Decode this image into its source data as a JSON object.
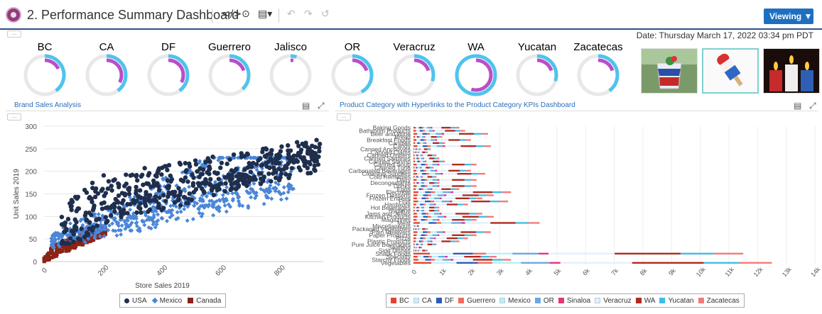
{
  "header": {
    "title": "2. Performance Summary Dashboard",
    "toolbar": {
      "code": "</>",
      "history": "⊙",
      "export": "▤▾",
      "undo": "↶",
      "redo": "↷",
      "reset": "↺"
    },
    "viewing_label": "Viewing ▼",
    "more": "..."
  },
  "date_text": "Date: Thursday March 17, 2022 03:34 pm PDT",
  "kpis": [
    {
      "label": "BC",
      "fraction": 0.18
    },
    {
      "label": "CA",
      "fraction": 0.33
    },
    {
      "label": "DF",
      "fraction": 0.33
    },
    {
      "label": "Guerrero",
      "fraction": 0.2
    },
    {
      "label": "Jalisco",
      "fraction": 0.03
    },
    {
      "label": "OR",
      "fraction": 0.2
    },
    {
      "label": "Veracruz",
      "fraction": 0.2
    },
    {
      "label": "WA",
      "fraction": 0.55
    },
    {
      "label": "Yucatan",
      "fraction": 0.2
    },
    {
      "label": "Zacatecas",
      "fraction": 0.2
    }
  ],
  "kpi_outer_fractions": [
    0.4,
    0.4,
    0.4,
    0.38,
    0.05,
    0.42,
    0.3,
    1.0,
    0.3,
    0.4
  ],
  "images": [
    {
      "name": "drink-image"
    },
    {
      "name": "popsicle-image"
    },
    {
      "name": "candles-image"
    }
  ],
  "panels": {
    "left_title": "Brand Sales Analysis",
    "right_title": "Product Category with Hyperlinks to the Product Category KPIs Dashboard"
  },
  "chart_data": [
    {
      "type": "scatter",
      "title": "",
      "xlabel": "Store Sales 2019",
      "ylabel": "Unit Sales 2019",
      "xlim": [
        0,
        950
      ],
      "ylim": [
        0,
        300
      ],
      "x_ticks": [
        "0",
        "200",
        "400",
        "600",
        "800"
      ],
      "y_ticks": [
        "0",
        "50",
        "100",
        "150",
        "200",
        "250",
        "300"
      ],
      "grid": true,
      "legend_position": "bottom",
      "series": [
        {
          "name": "USA",
          "color": "#1e2e4c",
          "marker": "circle",
          "x_range": [
            0,
            940
          ],
          "y_range": [
            15,
            270
          ]
        },
        {
          "name": "Mexico",
          "color": "#4a86d8",
          "marker": "diamond",
          "x_range": [
            0,
            850
          ],
          "y_range": [
            10,
            230
          ]
        },
        {
          "name": "Canada",
          "color": "#8b2317",
          "marker": "square",
          "x_range": [
            0,
            210
          ],
          "y_range": [
            0,
            75
          ]
        }
      ]
    },
    {
      "type": "bar",
      "orientation": "horizontal",
      "stacked": true,
      "title": "",
      "x_ticks": [
        "0",
        "1k",
        "2k",
        "3k",
        "4k",
        "5k",
        "6k",
        "7k",
        "8k",
        "9k",
        "10k",
        "11k",
        "12k",
        "13k",
        "14k"
      ],
      "xlim": [
        0,
        14000
      ],
      "categories": [
        "Baking Goods",
        "Bathroom Products",
        "Beer and Wine",
        "Bread",
        "Breakfast Foods",
        "Candles",
        "Candy",
        "Canned Anchovies",
        "Canned Clams",
        "Canned Oysters",
        "Canned Sardines",
        "Canned Shrimp",
        "Canned Soup",
        "Canned Tuna",
        "Carbonated Beverages",
        "Cleaning Supplies",
        "Cold Remedies",
        "Dairy",
        "Decongestants",
        "Drinks",
        "Eggs",
        "Electrical",
        "Frozen Desserts",
        "Frozen Entrees",
        "Fruit",
        "Hardware",
        "Hot Beverages",
        "Hygiene",
        "Jams and Jellies",
        "Kitchen Products",
        "Magazines",
        "Meat",
        "Miscellaneous",
        "Packaged Vegetables",
        "Pain Relievers",
        "Paper Products",
        "Pizza",
        "Plastic Products",
        "Pure Juice Beverages",
        "Seafood",
        "Side Dishes",
        "Snack Foods",
        "Specialty",
        "Starchy Foods",
        "Vegetables"
      ],
      "totals": [
        1600,
        1800,
        2600,
        1000,
        2000,
        1100,
        2700,
        600,
        500,
        800,
        900,
        1100,
        2200,
        700,
        2000,
        2500,
        800,
        2200,
        900,
        2200,
        1600,
        3400,
        2800,
        2400,
        3300,
        1900,
        900,
        900,
        2400,
        2800,
        2200,
        4400,
        200,
        500,
        2700,
        2200,
        1900,
        1600,
        800,
        300,
        500,
        11500,
        2900,
        3400,
        12500
      ],
      "series": [
        {
          "name": "BC",
          "color": "#e8402b"
        },
        {
          "name": "CA",
          "color": "#cdeef6"
        },
        {
          "name": "DF",
          "color": "#2d5bb8"
        },
        {
          "name": "Guerrero",
          "color": "#f26a5c"
        },
        {
          "name": "Mexico",
          "color": "#b8f0f4"
        },
        {
          "name": "OR",
          "color": "#6aa7e8"
        },
        {
          "name": "Sinaloa",
          "color": "#e53579"
        },
        {
          "name": "Veracruz",
          "color": "#e4f0fa"
        },
        {
          "name": "WA",
          "color": "#b02a1f"
        },
        {
          "name": "Yucatan",
          "color": "#3fbde8"
        },
        {
          "name": "Zacatecas",
          "color": "#f47a7a"
        }
      ],
      "series_shares": [
        0.05,
        0.07,
        0.06,
        0.04,
        0.08,
        0.08,
        0.03,
        0.2,
        0.2,
        0.1,
        0.09
      ]
    }
  ]
}
